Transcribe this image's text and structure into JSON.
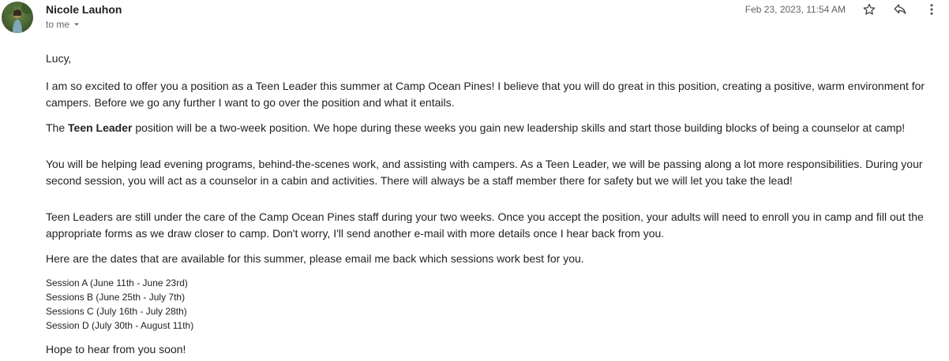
{
  "header": {
    "sender_name": "Nicole Lauhon",
    "to_label": "to me",
    "date": "Feb 23, 2023, 11:54 AM",
    "icons": [
      "star-icon",
      "reply-icon",
      "more-vert-icon"
    ]
  },
  "body": {
    "greeting": "Lucy,",
    "para1": "I am so excited to offer you a position as a Teen Leader this summer at Camp Ocean Pines! I believe that you will do great in this position, creating a positive, warm environment for campers. Before we go any further I want to go over the position and what it entails.",
    "para2_prefix": "The ",
    "para2_bold": "Teen Leader",
    "para2_rest": " position will be a two-week position. We hope during these weeks you gain new leadership skills and start those building blocks of being a counselor at camp!",
    "para3": "You will be helping lead evening programs, behind-the-scenes work, and assisting with campers. As a Teen Leader, we will be passing along a lot more responsibilities. During your second session, you will act as a counselor in a cabin and activities. There will always be a staff member there for safety but we will let you take the lead!",
    "para4": "Teen Leaders are still under the care of the Camp Ocean Pines staff during your two weeks. Once you accept the position, your adults will need to enroll you in camp and fill out the appropriate forms as we draw closer to camp. Don't worry, I'll send another e-mail with more details once I hear back from you.",
    "para5": "Here are the dates that are available for this summer, please email me back which sessions work best for you.",
    "sessions": [
      "Session A (June 11th - June 23rd)",
      "Sessions B (June 25th - July 7th)",
      "Sessions C (July 16th - July 28th)",
      "Session D (July 30th - August 11th)"
    ],
    "closing": "Hope to hear from you soon!"
  }
}
